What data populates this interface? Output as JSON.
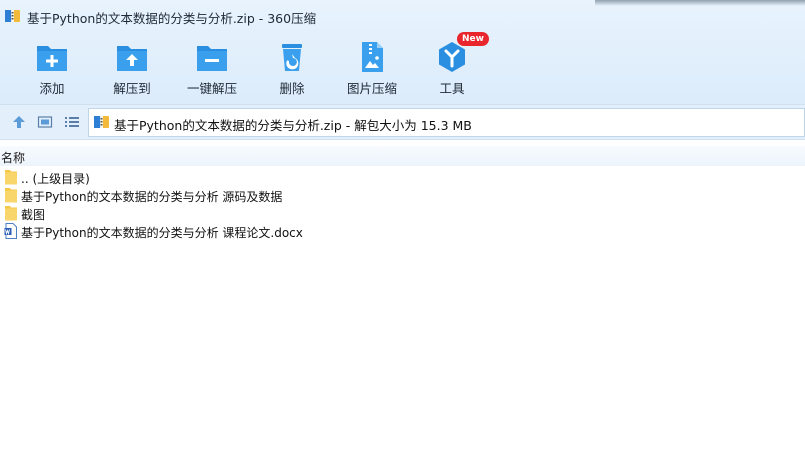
{
  "window": {
    "title": "基于Python的文本数据的分类与分析.zip - 360压缩"
  },
  "toolbar": {
    "items": [
      {
        "label": "添加",
        "icon": "add-folder-icon"
      },
      {
        "label": "解压到",
        "icon": "extract-to-icon"
      },
      {
        "label": "一键解压",
        "icon": "one-click-extract-icon"
      },
      {
        "label": "删除",
        "icon": "recycle-bin-icon"
      },
      {
        "label": "图片压缩",
        "icon": "image-compress-icon"
      },
      {
        "label": "工具",
        "icon": "tools-icon",
        "badge": "New"
      }
    ]
  },
  "nav": {
    "address": "基于Python的文本数据的分类与分析.zip - 解包大小为 15.3 MB"
  },
  "list": {
    "column_name": "名称",
    "rows": [
      {
        "name": ".. (上级目录)",
        "type": "folder"
      },
      {
        "name": "基于Python的文本数据的分类与分析 源码及数据",
        "type": "folder"
      },
      {
        "name": "截图",
        "type": "folder"
      },
      {
        "name": "基于Python的文本数据的分类与分析 课程论文.docx",
        "type": "docx"
      }
    ]
  },
  "colors": {
    "accent": "#2a8fe0",
    "badge": "#e8262c",
    "folder": "#f6c84a"
  }
}
